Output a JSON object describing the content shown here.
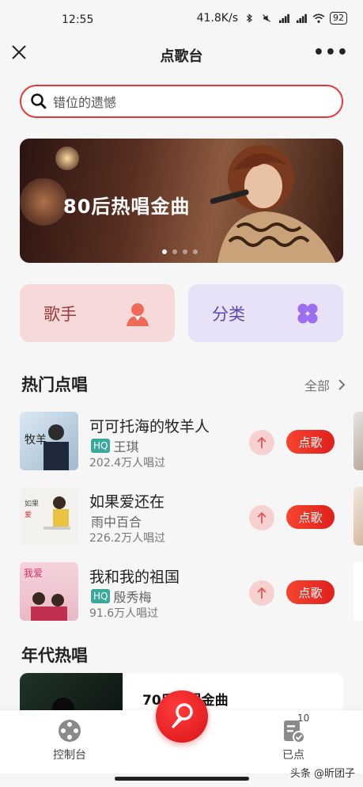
{
  "status_bar": {
    "time": "12:55",
    "network_speed": "41.8K/s",
    "battery": "92"
  },
  "nav": {
    "title": "点歌台",
    "more": "•••"
  },
  "search": {
    "placeholder": "错位的遗憾"
  },
  "banner": {
    "title": "80后热唱金曲",
    "page_count": 4,
    "active_index": 0
  },
  "categories": [
    {
      "label": "歌手",
      "icon": "singer-icon",
      "color": "#a03838"
    },
    {
      "label": "分类",
      "icon": "clover-icon",
      "color": "#5e46b0"
    }
  ],
  "hot_section": {
    "title": "热门点唱",
    "see_all": "全部"
  },
  "songs": [
    {
      "title": "可可托海的牧羊人",
      "hq": "HQ",
      "artist": "王琪",
      "plays": "202.4万人唱过",
      "action": "点歌"
    },
    {
      "title": "如果爱还在",
      "hq": "",
      "artist": "雨中百合",
      "plays": "226.2万人唱过",
      "action": "点歌"
    },
    {
      "title": "我和我的祖国",
      "hq": "HQ",
      "artist": "殷秀梅",
      "plays": "91.6万人唱过",
      "action": "点歌"
    }
  ],
  "era_section": {
    "title": "年代热唱",
    "first_card": "70后热唱金曲"
  },
  "tabbar": {
    "console": "控制台",
    "ordered": "已点",
    "ordered_count": "10"
  },
  "watermark": "头条 @昕团子",
  "colors": {
    "accent": "#e23a3a",
    "order_button": "#f0341f",
    "hq_badge": "#3aa89a"
  }
}
